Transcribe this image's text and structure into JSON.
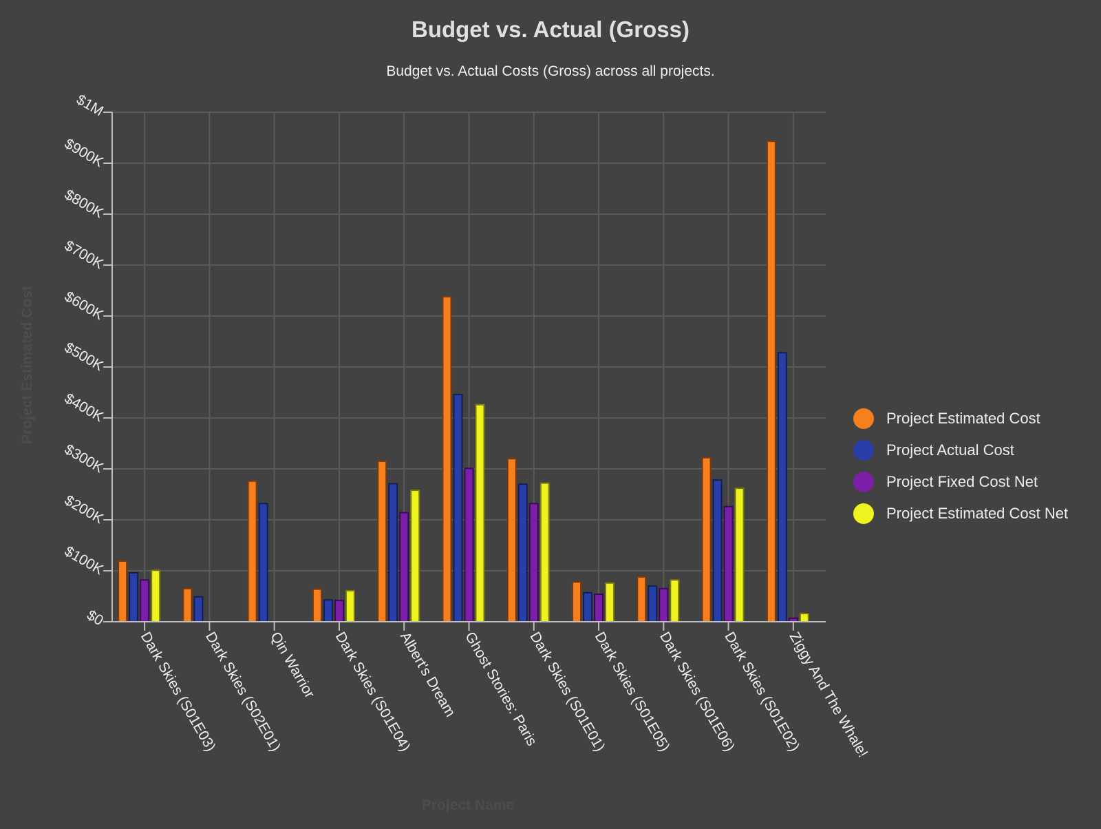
{
  "chart_data": {
    "type": "bar",
    "title": "Budget vs. Actual (Gross)",
    "subtitle": "Budget vs. Actual Costs (Gross) across all projects.",
    "xlabel": "Project Name",
    "ylabel": "Project Estimated Cost",
    "ylim": [
      0,
      1000000
    ],
    "yticks": [
      0,
      100000,
      200000,
      300000,
      400000,
      500000,
      600000,
      700000,
      800000,
      900000,
      1000000
    ],
    "ytick_labels": [
      "$0",
      "$100K",
      "$200K",
      "$300K",
      "$400K",
      "$500K",
      "$600K",
      "$700K",
      "$800K",
      "$900K",
      "$1M"
    ],
    "grid": true,
    "legend_position": "right",
    "categories": [
      "Dark Skies (S01E03)",
      "Dark Skies (S02E01)",
      "Qin Warrior",
      "Dark Skies (S01E04)",
      "Albert's Dream",
      "Ghost Stories: Paris",
      "Dark Skies (S01E01)",
      "Dark Skies (S01E05)",
      "Dark Skies (S01E06)",
      "Dark Skies (S01E02)",
      "Ziggy And The Whale!"
    ],
    "series": [
      {
        "name": "Project Estimated Cost",
        "color": "#f77f1e",
        "border": "#7a3a0c",
        "values": [
          119000,
          65000,
          276000,
          64000,
          315000,
          638000,
          320000,
          78000,
          88000,
          322000,
          943000
        ]
      },
      {
        "name": "Project Actual Cost",
        "color": "#283ea8",
        "border": "#121f55",
        "values": [
          96000,
          49000,
          232000,
          43000,
          271000,
          446000,
          270000,
          57000,
          70000,
          278000,
          528000
        ]
      },
      {
        "name": "Project Fixed Cost Net",
        "color": "#7b1ea8",
        "border": "#3a0c55",
        "values": [
          82000,
          null,
          null,
          42000,
          214000,
          301000,
          232000,
          54000,
          65000,
          226000,
          7000
        ]
      },
      {
        "name": "Project Estimated Cost Net",
        "color": "#eef21e",
        "border": "#7a7a10",
        "values": [
          101000,
          null,
          null,
          61000,
          258000,
          426000,
          272000,
          76000,
          82000,
          262000,
          16000
        ]
      }
    ]
  }
}
